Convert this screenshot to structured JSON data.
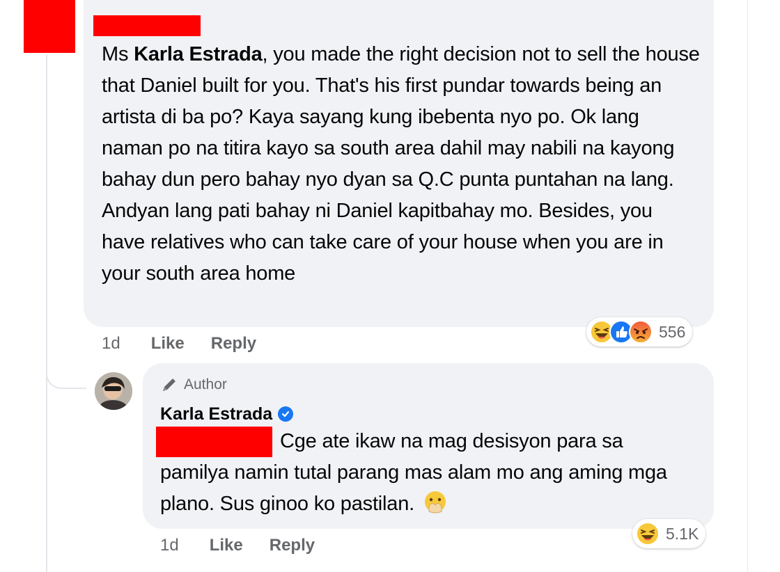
{
  "comment": {
    "lead": "Ms ",
    "mention": "Karla Estrada",
    "text": ", you made the right decision not to sell the house that Daniel built for you. That's his first pundar towards being an artista di ba po? Kaya sayang kung ibebenta nyo po. Ok lang naman po na titira kayo sa south area dahil may nabili na kayong bahay dun pero bahay nyo dyan sa Q.C punta puntahan na lang. Andyan lang pati bahay ni Daniel kapitbahay mo. Besides, you have relatives who can take care of your house when you are in your south area home",
    "time": "1d",
    "like_label": "Like",
    "reply_label": "Reply",
    "reactions": [
      "haha-icon",
      "like-icon",
      "angry-icon"
    ],
    "reaction_count": "556"
  },
  "reply": {
    "badge": "Author",
    "author_name": "Karla Estrada",
    "text": "Cge ate ikaw na mag desisyon para sa pamilya namin tutal parang mas alam mo ang aming mga plano. Sus ginoo ko pastilan.",
    "emoji": "hand-over-mouth-icon",
    "time": "1d",
    "like_label": "Like",
    "reply_label": "Reply",
    "reactions": [
      "haha-icon"
    ],
    "reaction_count": "5.1K"
  },
  "colors": {
    "bubble": "#f0f2f5",
    "redaction": "#ff0000",
    "meta": "#65676b",
    "verified": "#1877f2"
  }
}
